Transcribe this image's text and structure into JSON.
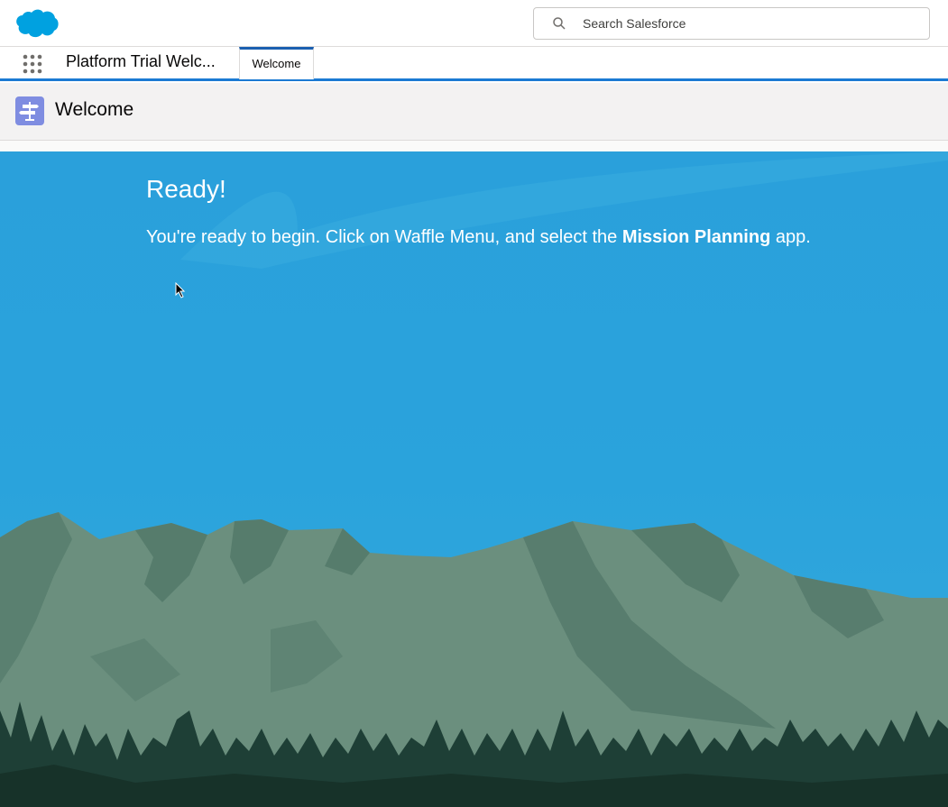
{
  "header": {
    "logo": "salesforce-cloud-logo",
    "search": {
      "placeholder": "Search Salesforce",
      "value": ""
    }
  },
  "nav": {
    "app_name": "Platform Trial Welc...",
    "tabs": [
      {
        "label": "Welcome",
        "active": true
      }
    ]
  },
  "page": {
    "title": "Welcome",
    "icon": "signpost-icon"
  },
  "hero": {
    "title": "Ready!",
    "message_before": "You're ready to begin. Click on Waffle Menu, and select the ",
    "message_bold": "Mission Planning",
    "message_after": " app."
  },
  "colors": {
    "brand": "#00a1e0",
    "sky": "#2aa3dc",
    "mountain": "#6b8f7e",
    "mountain_shadow": "#4f7567",
    "trees": "#1e3f36",
    "tab_accent": "#1b7ad3",
    "page_icon": "#7f8de1"
  }
}
